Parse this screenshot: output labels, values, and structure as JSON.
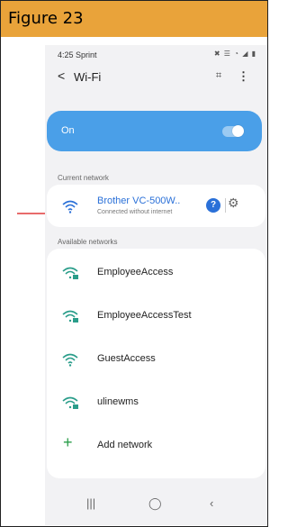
{
  "figure": {
    "title": "Figure 23"
  },
  "status_bar": {
    "time": "4:25 Sprint",
    "icons": "✖ ☰ ◔ ◢ ▮"
  },
  "header": {
    "back_icon": "chevron-left-icon",
    "title": "Wi-Fi"
  },
  "wifi_toggle": {
    "label": "On",
    "state": "on",
    "color": "#4a9fe8"
  },
  "current_network": {
    "section_label": "Current network",
    "name": "Brother VC-500W..",
    "status": "Connected without internet",
    "help_label": "?",
    "accent_color": "#2a70d8"
  },
  "available_networks": {
    "section_label": "Available networks",
    "items": [
      {
        "name": "EmployeeAccess",
        "locked": true
      },
      {
        "name": "EmployeeAccessTest",
        "locked": true
      },
      {
        "name": "GuestAccess",
        "locked": false
      },
      {
        "name": "ulinewms",
        "locked": true
      }
    ],
    "add_label": "Add network"
  },
  "bottom_nav": {
    "recent": "|||",
    "home": "◯",
    "back": "‹"
  },
  "annotation": {
    "arrow_color": "#e03a3a"
  }
}
